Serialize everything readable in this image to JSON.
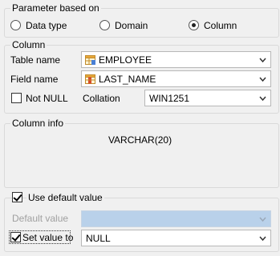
{
  "param_group": {
    "title": "Parameter based on",
    "options": [
      {
        "label": "Data type",
        "selected": false
      },
      {
        "label": "Domain",
        "selected": false
      },
      {
        "label": "Column",
        "selected": true
      }
    ]
  },
  "column_group": {
    "title": "Column",
    "table_label": "Table name",
    "table_value": "EMPLOYEE",
    "field_label": "Field name",
    "field_value": "LAST_NAME",
    "not_null_label": "Not NULL",
    "not_null_checked": false,
    "collation_label": "Collation",
    "collation_value": "WIN1251"
  },
  "column_info": {
    "title": "Column info",
    "type_text": "VARCHAR(20)"
  },
  "default_group": {
    "use_default_label": "Use default value",
    "use_default_checked": true,
    "default_value_label": "Default value",
    "default_value": "",
    "set_value_label": "Set value to",
    "set_value_checked": true,
    "set_value_value": "NULL"
  },
  "icons": {
    "table_icon": "table-icon",
    "field_icon": "field-icon",
    "dropdown_icon": "chevron-down-icon"
  }
}
